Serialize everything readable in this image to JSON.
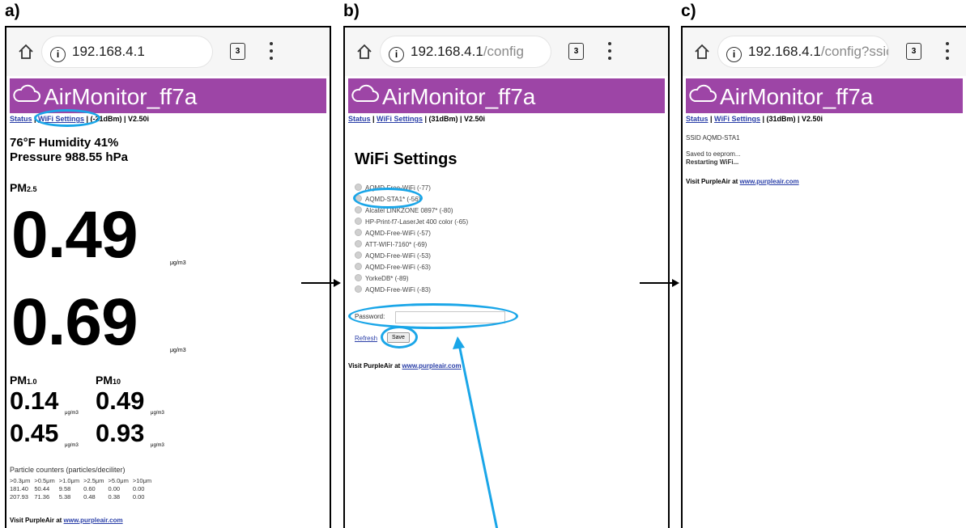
{
  "panels": {
    "a": {
      "letter": "a)",
      "url_host": "192.168.4.1",
      "url_path": "",
      "title": "AirMonitor_ff7a",
      "nav": {
        "status": "Status",
        "wifi": "WiFi Settings",
        "rest": "(-21dBm) | V2.50i"
      },
      "weather": {
        "line1": "76°F Humidity 41%",
        "line2": "Pressure 988.55 hPa"
      },
      "pm25_label": "PM",
      "pm25_sub": "2.5",
      "pm25_values": [
        "0.49",
        "0.69"
      ],
      "unit": "μg/m3",
      "pm1_label": "PM",
      "pm1_sub": "1.0",
      "pm10_label": "PM",
      "pm10_sub": "10",
      "pm1_values": [
        "0.14",
        "0.45"
      ],
      "pm10_values": [
        "0.49",
        "0.93"
      ],
      "counters_title": "Particle counters (particles/deciliter)",
      "counters_headers": [
        ">0.3μm",
        ">0.5μm",
        ">1.0μm",
        ">2.5μm",
        ">5.0μm",
        ">10μm"
      ],
      "counters_rows": [
        [
          "181.40",
          "50.44",
          "9.58",
          "0.60",
          "0.00",
          "0.00"
        ],
        [
          "207.93",
          "71.36",
          "5.38",
          "0.48",
          "0.38",
          "0.00"
        ]
      ],
      "visit_text": "Visit PurpleAir at ",
      "visit_link": "www.purpleair.com"
    },
    "b": {
      "letter": "b)",
      "url_host": "192.168.4.1",
      "url_path": "/config",
      "title": "AirMonitor_ff7a",
      "nav": {
        "status": "Status",
        "wifi": "WiFi Settings",
        "rest": "(31dBm) | V2.50i"
      },
      "heading": "WiFi Settings",
      "networks": [
        "AQMD-Free-WiFi (-77)",
        "AQMD-STA1* (-56)",
        "Alcatel LINKZONE 0897* (-80)",
        "HP-Print-f7-LaserJet 400 color (-65)",
        "AQMD-Free-WiFi (-57)",
        "ATT-WIFI-7160* (-69)",
        "AQMD-Free-WiFi (-53)",
        "AQMD-Free-WiFi (-63)",
        "YorkeDB* (-89)",
        "AQMD-Free-WiFi (-83)"
      ],
      "password_label": "Password:",
      "refresh_label": "Refresh",
      "save_label": "Save",
      "visit_text": "Visit PurpleAir at ",
      "visit_link": "www.purpleair.com"
    },
    "c": {
      "letter": "c)",
      "url_host": "192.168.4.1",
      "url_path": "/config?ssid",
      "title": "AirMonitor_ff7a",
      "nav": {
        "status": "Status",
        "wifi": "WiFi Settings",
        "rest": "(31dBm) | V2.50i"
      },
      "ssid_line": "SSID AQMD-STA1",
      "saved_line": "Saved to eeprom...",
      "restart_line": "Restarting WiFi...",
      "visit_text": "Visit PurpleAir at ",
      "visit_link": "www.purpleair.com"
    }
  },
  "browser": {
    "tab_count": "3"
  },
  "colors": {
    "banner": "#9d45a6",
    "highlight": "#1aa6e8",
    "link": "#2a3fa8"
  }
}
